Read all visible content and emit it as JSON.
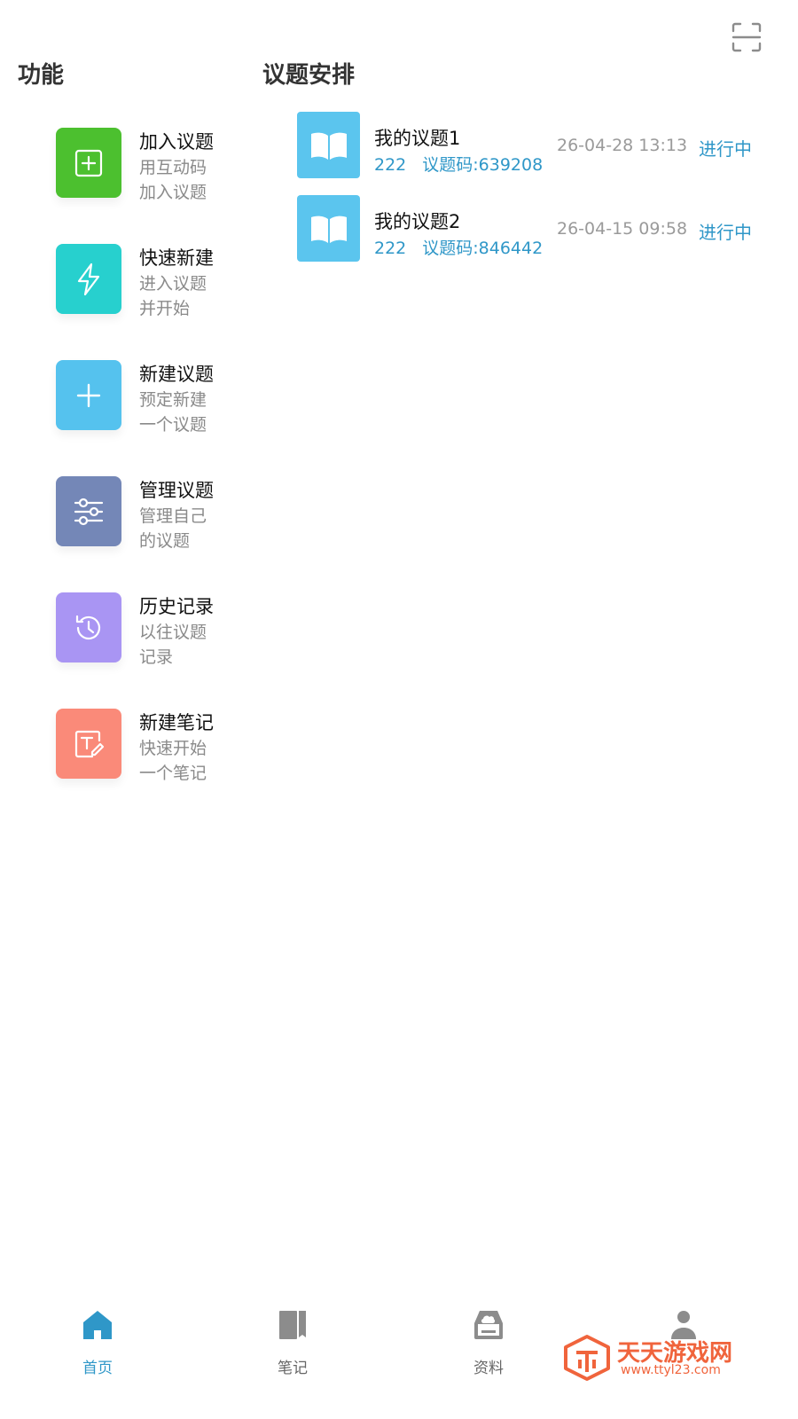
{
  "scan": {
    "icon": "scan-icon"
  },
  "sections": {
    "features_title": "功能",
    "schedule_title": "议题安排"
  },
  "features": [
    {
      "title": "加入议题",
      "desc": "用互动码加入议题",
      "color": "#4cc02f",
      "icon": "plus-square-icon"
    },
    {
      "title": "快速新建",
      "desc": "进入议题并开始",
      "color": "#27d0ce",
      "icon": "lightning-icon"
    },
    {
      "title": "新建议题",
      "desc": "预定新建一个议题",
      "color": "#55c2ee",
      "icon": "plus-icon"
    },
    {
      "title": "管理议题",
      "desc": "管理自己的议题",
      "color": "#7487b7",
      "icon": "sliders-icon"
    },
    {
      "title": "历史记录",
      "desc": "以往议题记录",
      "color": "#a995f3",
      "icon": "history-icon"
    },
    {
      "title": "新建笔记",
      "desc": "快速开始一个笔记",
      "color": "#fa8a79",
      "icon": "note-edit-icon"
    }
  ],
  "topics": [
    {
      "name": "我的议题1",
      "number": "222",
      "code": "议题码:639208",
      "time": "26-04-28 13:13",
      "status": "进行中"
    },
    {
      "name": "我的议题2",
      "number": "222",
      "code": "议题码:846442",
      "time": "26-04-15 09:58",
      "status": "进行中"
    }
  ],
  "nav": {
    "home": "首页",
    "notes": "笔记",
    "materials": "资料"
  },
  "watermark": {
    "text": "天天游戏网",
    "url": "www.ttyl23.com"
  },
  "colors": {
    "accent": "#2f97c8",
    "book_tile": "#5bc5ee"
  }
}
